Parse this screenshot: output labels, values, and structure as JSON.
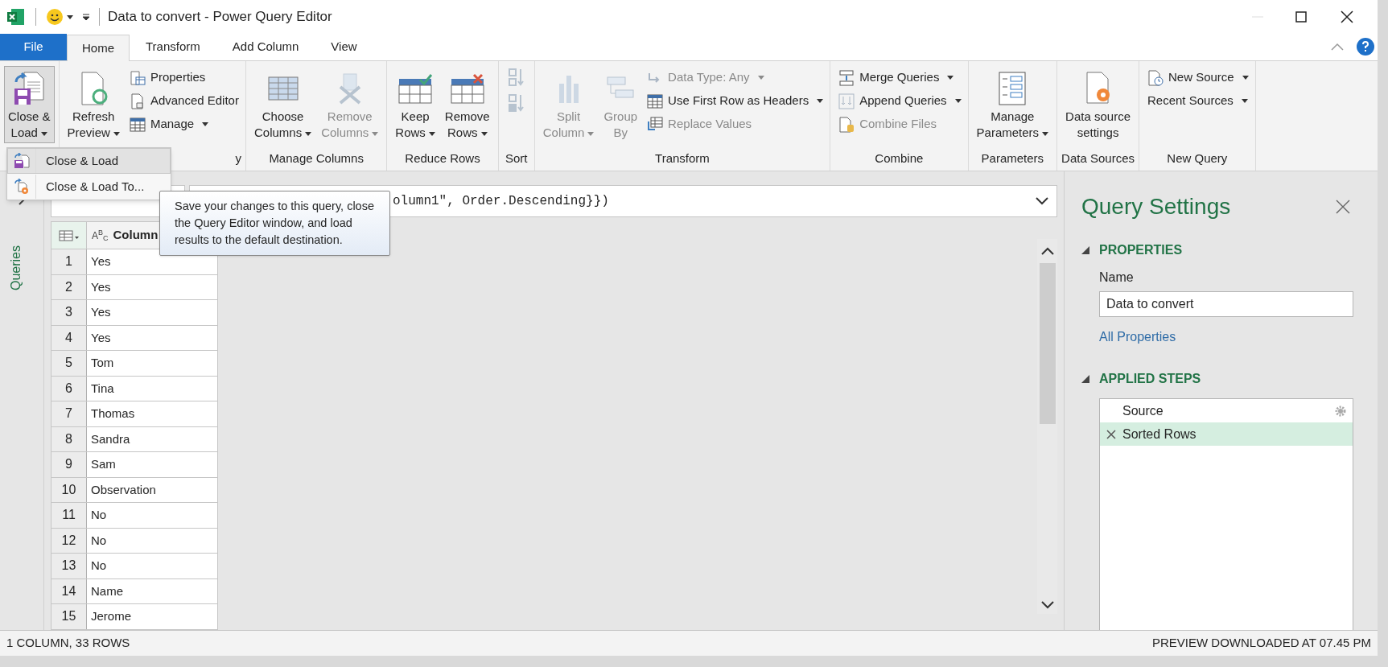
{
  "window": {
    "title": "Data to convert - Power Query Editor"
  },
  "tabs": [
    {
      "label": "File",
      "kind": "file",
      "selected": false
    },
    {
      "label": "Home",
      "kind": "tab",
      "selected": true
    },
    {
      "label": "Transform",
      "kind": "tab",
      "selected": false
    },
    {
      "label": "Add Column",
      "kind": "tab",
      "selected": false
    },
    {
      "label": "View",
      "kind": "tab",
      "selected": false
    }
  ],
  "ribbon": [
    {
      "items": [
        {
          "kind": "large",
          "lines": [
            "Close &",
            "Load"
          ],
          "dropdown": true,
          "disabled": false,
          "pressed": true
        }
      ]
    },
    {
      "label": "y",
      "items": [
        {
          "kind": "large",
          "lines": [
            "Refresh",
            "Preview"
          ],
          "dropdown": true,
          "disabled": false,
          "pressed": false
        },
        {
          "kind": "small",
          "lines": [
            "Properties"
          ],
          "dropdown": false,
          "disabled": false
        },
        {
          "kind": "small",
          "lines": [
            "Advanced Editor"
          ],
          "dropdown": false,
          "disabled": false
        },
        {
          "kind": "small",
          "lines": [
            "Manage"
          ],
          "dropdown": true,
          "disabled": false
        }
      ]
    },
    {
      "label": "Manage Columns",
      "items": [
        {
          "kind": "large",
          "lines": [
            "Choose",
            "Columns"
          ],
          "dropdown": true,
          "disabled": false,
          "pressed": false
        },
        {
          "kind": "large",
          "lines": [
            "Remove",
            "Columns"
          ],
          "dropdown": true,
          "disabled": true,
          "pressed": false
        }
      ]
    },
    {
      "label": "Reduce Rows",
      "items": [
        {
          "kind": "large",
          "lines": [
            "Keep",
            "Rows"
          ],
          "dropdown": true,
          "disabled": false,
          "pressed": false
        },
        {
          "kind": "large",
          "lines": [
            "Remove",
            "Rows"
          ],
          "dropdown": true,
          "disabled": false,
          "pressed": false
        }
      ]
    },
    {
      "label": "Sort",
      "items": [
        {
          "kind": "icon",
          "disabled": true
        },
        {
          "kind": "icon",
          "disabled": true
        }
      ]
    },
    {
      "label": "Transform",
      "items": [
        {
          "kind": "large",
          "lines": [
            "Split",
            "Column"
          ],
          "dropdown": true,
          "disabled": true,
          "pressed": false
        },
        {
          "kind": "large",
          "lines": [
            "Group",
            "By"
          ],
          "dropdown": false,
          "disabled": true,
          "pressed": false
        },
        {
          "kind": "small",
          "lines": [
            "Data Type: Any"
          ],
          "dropdown": true,
          "disabled": true
        },
        {
          "kind": "small",
          "lines": [
            "Use First Row as Headers"
          ],
          "dropdown": true,
          "disabled": false
        },
        {
          "kind": "small",
          "lines": [
            "Replace Values"
          ],
          "dropdown": false,
          "disabled": true
        }
      ]
    },
    {
      "label": "Combine",
      "items": [
        {
          "kind": "small",
          "lines": [
            "Merge Queries"
          ],
          "dropdown": true,
          "disabled": false
        },
        {
          "kind": "small",
          "lines": [
            "Append Queries"
          ],
          "dropdown": true,
          "disabled": false
        },
        {
          "kind": "small",
          "lines": [
            "Combine Files"
          ],
          "dropdown": false,
          "disabled": true
        }
      ]
    },
    {
      "label": "Parameters",
      "items": [
        {
          "kind": "large",
          "lines": [
            "Manage",
            "Parameters"
          ],
          "dropdown": true,
          "disabled": false,
          "pressed": false
        }
      ]
    },
    {
      "label": "Data Sources",
      "items": [
        {
          "kind": "large",
          "lines": [
            "Data source",
            "settings"
          ],
          "dropdown": false,
          "disabled": false,
          "pressed": false
        }
      ]
    },
    {
      "label": "New Query",
      "items": [
        {
          "kind": "small",
          "lines": [
            "New Source"
          ],
          "dropdown": true,
          "disabled": false
        },
        {
          "kind": "small",
          "lines": [
            "Recent Sources"
          ],
          "dropdown": true,
          "disabled": false
        }
      ]
    }
  ],
  "menu": [
    {
      "label": "Close & Load",
      "selected": true
    },
    {
      "label": "Close & Load To...",
      "selected": false
    }
  ],
  "tooltip": "Save your changes to this query, close the Query Editor window, and load results to the default destination.",
  "queries_pane": {
    "label": "Queries"
  },
  "formula": "olumn1\", Order.Descending}})",
  "table": {
    "type_badge": "A$^{B}$$_{C}$",
    "column": "Column",
    "rows": [
      {
        "n": "1",
        "v": "Yes"
      },
      {
        "n": "2",
        "v": "Yes"
      },
      {
        "n": "3",
        "v": "Yes"
      },
      {
        "n": "4",
        "v": "Yes"
      },
      {
        "n": "5",
        "v": "Tom"
      },
      {
        "n": "6",
        "v": "Tina"
      },
      {
        "n": "7",
        "v": "Thomas"
      },
      {
        "n": "8",
        "v": "Sandra"
      },
      {
        "n": "9",
        "v": "Sam"
      },
      {
        "n": "10",
        "v": "Observation"
      },
      {
        "n": "11",
        "v": "No"
      },
      {
        "n": "12",
        "v": "No"
      },
      {
        "n": "13",
        "v": "No"
      },
      {
        "n": "14",
        "v": "Name"
      },
      {
        "n": "15",
        "v": "Jerome"
      }
    ]
  },
  "settings": {
    "title": "Query Settings",
    "properties": {
      "heading": "PROPERTIES",
      "expanded": true,
      "name_label": "Name",
      "name_value": "Data to convert",
      "link": "All Properties"
    },
    "steps": {
      "heading": "APPLIED STEPS",
      "expanded": true,
      "items": [
        {
          "label": "Source",
          "selected": false
        },
        {
          "label": "Sorted Rows",
          "selected": true
        }
      ]
    }
  },
  "status_bar": {
    "left": "1 COLUMN, 33 ROWS",
    "right": "PREVIEW DOWNLOADED AT 07.45 PM"
  }
}
